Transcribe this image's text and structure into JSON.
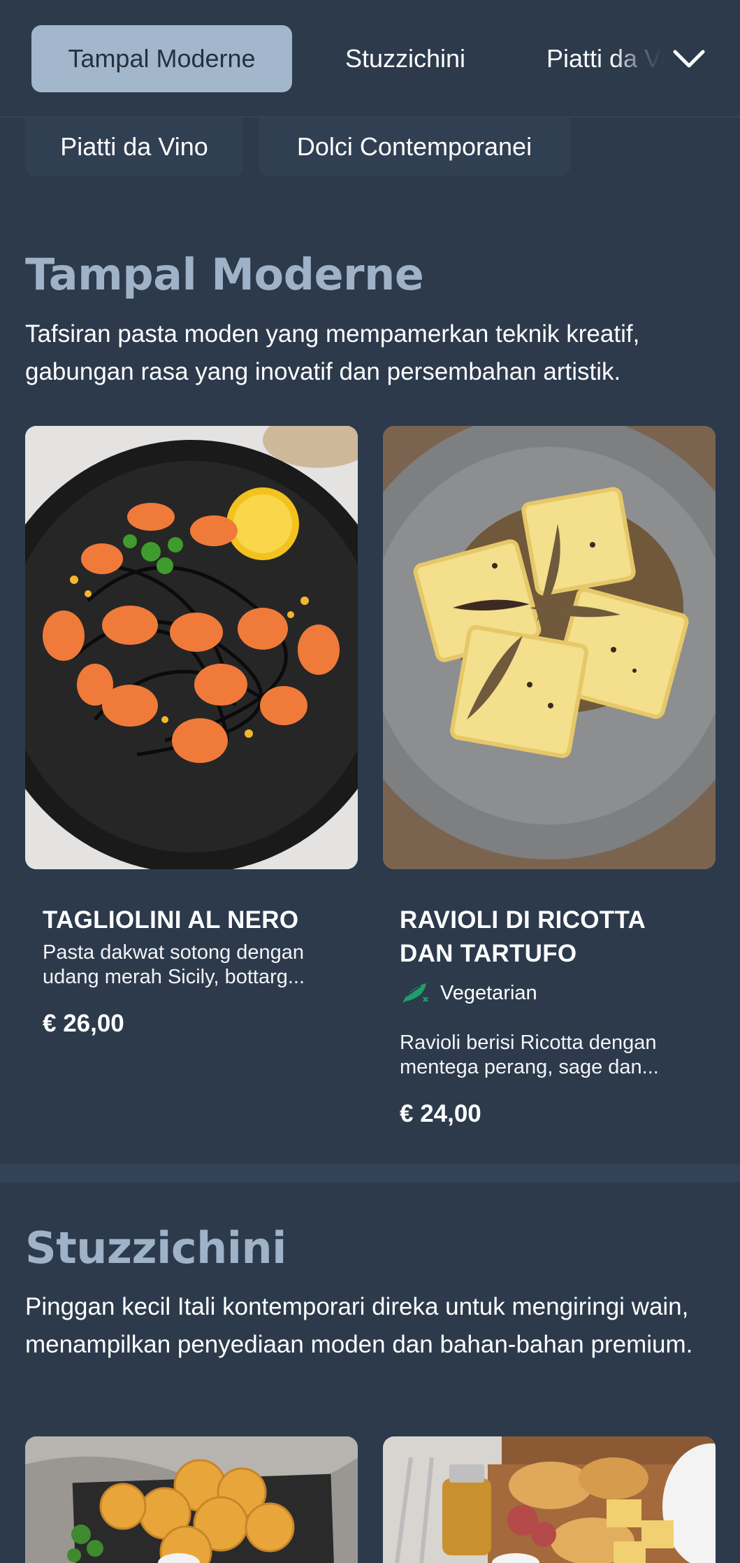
{
  "nav": {
    "tabs": [
      {
        "label": "Tampal Moderne",
        "active": true
      },
      {
        "label": "Stuzzichini",
        "active": false
      },
      {
        "label": "Piatti da Vino",
        "active": false
      }
    ],
    "chips": [
      "Piatti da Vino",
      "Dolci Contemporanei"
    ],
    "expand_icon": "chevron-down-icon"
  },
  "sections": [
    {
      "title": "Tampal Moderne",
      "description": "Tafsiran pasta moden yang mempamerkan teknik kreatif, gabungan rasa yang inovatif dan persembahan artistik.",
      "items": [
        {
          "name": "TAGLIOLINI AL NERO",
          "description": "Pasta dakwat sotong dengan udang merah Sicily, bottarg...",
          "price": "€ 26,00"
        },
        {
          "name": "RAVIOLI DI RICOTTA DAN TARTUFO",
          "badge": "Vegetarian",
          "description": "Ravioli berisi Ricotta dengan mentega perang, sage dan...",
          "price": "€ 24,00"
        }
      ]
    },
    {
      "title": "Stuzzichini",
      "description": "Pinggan kecil Itali kontemporari direka untuk mengiringi wain, menampilkan penyediaan moden dan bahan-bahan premium."
    }
  ],
  "colors": {
    "background": "#2c3a4c",
    "accent": "#a3b7cc",
    "heading": "#9fb2c7",
    "vegetarian": "#1f9d6a"
  }
}
